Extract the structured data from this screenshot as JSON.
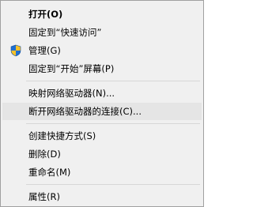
{
  "menu": {
    "items": [
      {
        "label": "打开(O)",
        "bold": true
      },
      {
        "label": "固定到“快速访问”"
      },
      {
        "label": "管理(G)",
        "icon": "shield-icon"
      },
      {
        "label": "固定到“开始”屏幕(P)"
      },
      {
        "label": "映射网络驱动器(N)..."
      },
      {
        "label": "断开网络驱动器的连接(C)...",
        "highlighted": true
      },
      {
        "label": "创建快捷方式(S)"
      },
      {
        "label": "删除(D)"
      },
      {
        "label": "重命名(M)"
      },
      {
        "label": "属性(R)"
      }
    ]
  },
  "colors": {
    "menu_background": "#f0f0f0",
    "hover_background": "#e5e5e5",
    "separator": "#d7d7d7",
    "border": "#a0a0a0",
    "shield_blue": "#1f6fd1",
    "shield_yellow": "#f6c12a"
  }
}
